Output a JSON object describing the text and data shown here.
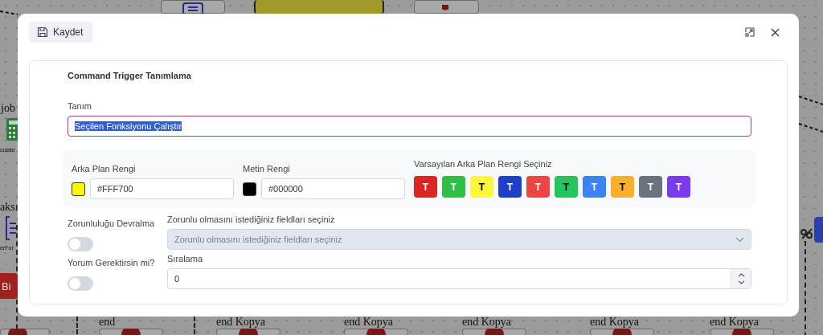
{
  "canvas": {
    "labels": [
      {
        "text": "job"
      },
      {
        "text": "culate"
      },
      {
        "text": "aksı"
      },
      {
        "text": "erFor"
      },
      {
        "text": "end"
      },
      {
        "text": "end Kopya"
      },
      {
        "text": "end Kopya"
      },
      {
        "text": "end Kopya"
      },
      {
        "text": "end Kopya"
      },
      {
        "text": "end Kopya"
      }
    ],
    "buttons": [
      {
        "label": "Bi"
      }
    ]
  },
  "dialog": {
    "save_button": "Kaydet",
    "title": "Command Trigger Tanımlama",
    "definition": {
      "label": "Tanım",
      "value": "Seçilen Fonksiyonu Çalıştır",
      "selected": true
    },
    "background_color": {
      "label": "Arka Plan Rengi",
      "value": "#FFF700",
      "color": "#fff700"
    },
    "text_color": {
      "label": "Metin Rengi",
      "value": "#000000",
      "color": "#000000"
    },
    "presets": {
      "label": "Varsayılan Arka Plan Rengi Seçiniz",
      "items": [
        {
          "label": "T",
          "color": "#dc2626",
          "kind": "light"
        },
        {
          "label": "T",
          "color": "#2fbf47",
          "kind": "light"
        },
        {
          "label": "T",
          "color": "#fff73a",
          "kind": "dark"
        },
        {
          "label": "T",
          "color": "#1e40c8",
          "kind": "light"
        },
        {
          "label": "T",
          "color": "#ef4444",
          "kind": "light"
        },
        {
          "label": "T",
          "color": "#22c55e",
          "kind": "dark"
        },
        {
          "label": "T",
          "color": "#3b82f6",
          "kind": "light"
        },
        {
          "label": "T",
          "color": "#fbaf2a",
          "kind": "dark"
        },
        {
          "label": "T",
          "color": "#6b7280",
          "kind": "light"
        },
        {
          "label": "T",
          "color": "#7c3aed",
          "kind": "light"
        }
      ]
    },
    "toggles": [
      {
        "label": "Zorunluluğu Devralma",
        "on": false
      },
      {
        "label": "Yorum Gerektirsin mi?",
        "on": false
      }
    ],
    "required_fields": {
      "label": "Zorunlu olmasını istediğiniz fieldları seçiniz",
      "placeholder": "Zorunlu olmasını istediğiniz fieldları seçiniz",
      "disabled": true
    },
    "order": {
      "label": "Sıralama",
      "value": "0"
    }
  }
}
